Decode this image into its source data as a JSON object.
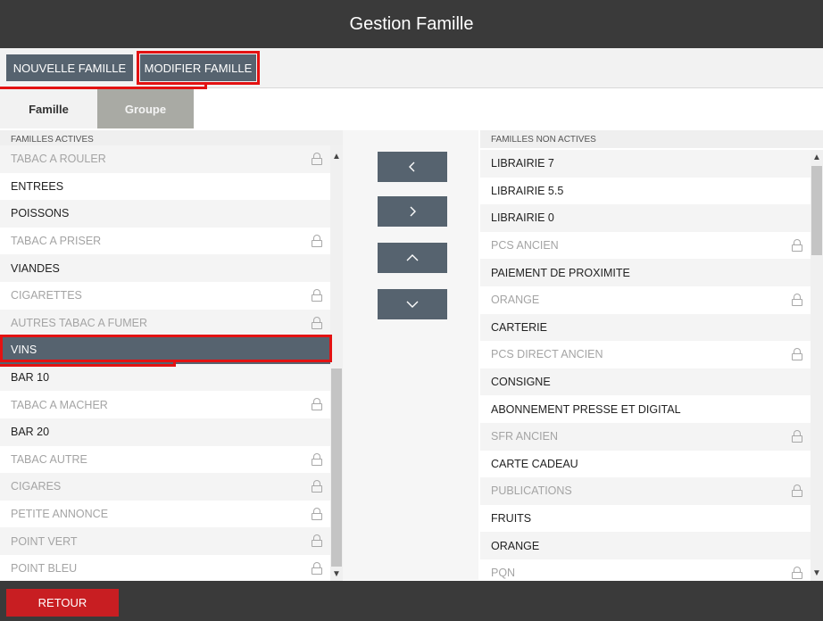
{
  "window": {
    "title": "Gestion Famille"
  },
  "toolbar": {
    "new_label": "NOUVELLE FAMILLE",
    "modify_label": "MODIFIER FAMILLE"
  },
  "tabs": [
    {
      "label": "Famille",
      "active": true
    },
    {
      "label": "Groupe",
      "active": false
    }
  ],
  "active_families": {
    "header": "FAMILLES ACTIVES",
    "items": [
      {
        "label": "TABAC A ROULER",
        "locked": true
      },
      {
        "label": "ENTREES",
        "locked": false
      },
      {
        "label": "POISSONS",
        "locked": false
      },
      {
        "label": "TABAC A PRISER",
        "locked": true
      },
      {
        "label": "VIANDES",
        "locked": false
      },
      {
        "label": "CIGARETTES",
        "locked": true
      },
      {
        "label": "AUTRES TABAC A FUMER",
        "locked": true
      },
      {
        "label": "VINS",
        "locked": false,
        "selected": true
      },
      {
        "label": "BAR 10",
        "locked": false
      },
      {
        "label": "TABAC A MACHER",
        "locked": true
      },
      {
        "label": "BAR 20",
        "locked": false
      },
      {
        "label": "TABAC AUTRE",
        "locked": true
      },
      {
        "label": "CIGARES",
        "locked": true
      },
      {
        "label": "PETITE ANNONCE",
        "locked": true
      },
      {
        "label": "POINT VERT",
        "locked": true
      },
      {
        "label": "POINT BLEU",
        "locked": true
      }
    ]
  },
  "inactive_families": {
    "header": "FAMILLES NON ACTIVES",
    "items": [
      {
        "label": "LIBRAIRIE 7",
        "locked": false
      },
      {
        "label": "LIBRAIRIE 5.5",
        "locked": false
      },
      {
        "label": "LIBRAIRIE 0",
        "locked": false
      },
      {
        "label": "PCS ANCIEN",
        "locked": true
      },
      {
        "label": "PAIEMENT DE PROXIMITE",
        "locked": false
      },
      {
        "label": "ORANGE",
        "locked": true
      },
      {
        "label": "CARTERIE",
        "locked": false
      },
      {
        "label": "PCS DIRECT ANCIEN",
        "locked": true
      },
      {
        "label": "CONSIGNE",
        "locked": false
      },
      {
        "label": "ABONNEMENT PRESSE ET DIGITAL",
        "locked": false
      },
      {
        "label": "SFR ANCIEN",
        "locked": true
      },
      {
        "label": "CARTE CADEAU",
        "locked": false
      },
      {
        "label": "PUBLICATIONS",
        "locked": true
      },
      {
        "label": "FRUITS",
        "locked": false
      },
      {
        "label": "ORANGE",
        "locked": false
      },
      {
        "label": "PQN",
        "locked": true
      }
    ]
  },
  "middle_buttons": [
    {
      "name": "move-left-button",
      "icon": "chevron-left-icon"
    },
    {
      "name": "move-right-button",
      "icon": "chevron-right-icon"
    },
    {
      "name": "move-up-button",
      "icon": "chevron-up-icon"
    },
    {
      "name": "move-down-button",
      "icon": "chevron-down-icon"
    }
  ],
  "footer": {
    "return_label": "RETOUR"
  },
  "colors": {
    "accent": "#56636f",
    "highlight": "#e31212",
    "danger": "#c81e22",
    "bar": "#3a3a3a"
  }
}
